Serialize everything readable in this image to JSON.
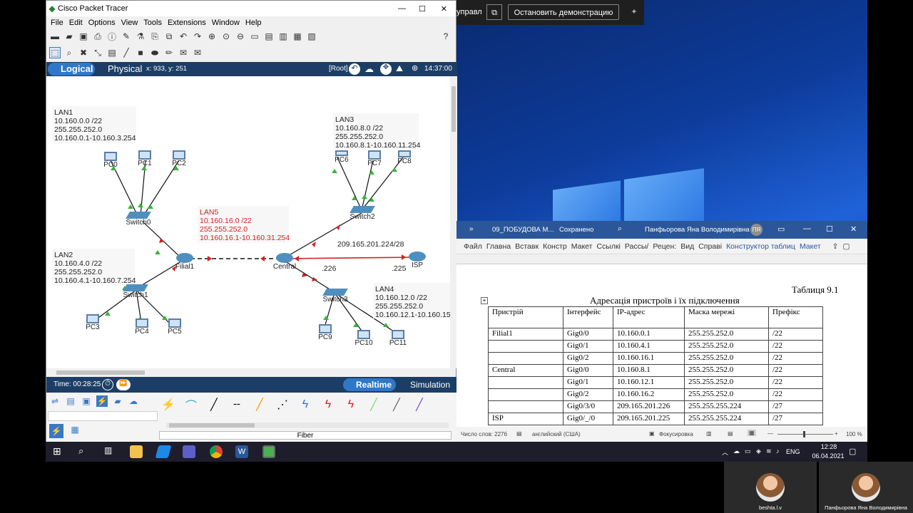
{
  "pt": {
    "title": "Cisco Packet Tracer",
    "menu": [
      "File",
      "Edit",
      "Options",
      "View",
      "Tools",
      "Extensions",
      "Window",
      "Help"
    ],
    "tab_logical": "Logical",
    "tab_physical": "Physical",
    "coords": "x: 933, y: 251",
    "root": "[Root]",
    "clock": "14:37:00",
    "time": "Time: 00:28:25",
    "realtime": "Realtime",
    "simulation": "Simulation",
    "cable_label": "Fiber"
  },
  "topology": {
    "lan1": [
      "LAN1",
      "10.160.0.0 /22",
      "255.255.252.0",
      "10.160.0.1-10.160.3.254"
    ],
    "lan2": [
      "LAN2",
      "10.160.4.0 /22",
      "255.255.252.0",
      "10.160.4.1-10.160.7.254"
    ],
    "lan3": [
      "LAN3",
      "10.160.8.0 /22",
      "255.255.252.0",
      "10.160.8.1-10.160.11.254"
    ],
    "lan4": [
      "LAN4",
      "10.160.12.0 /22",
      "255.255.252.0",
      "10.160.12.1-10.160.15"
    ],
    "lan5": [
      "LAN5",
      "10.160.16.0 /22",
      "255.255.252.0",
      "10.160.16.1-10.160.31.254"
    ],
    "isp_net": "209.165.201.224/28",
    "ip226": ".226",
    "ip225": ".225",
    "devices": {
      "pc0": "PC0",
      "pc1": "PC1",
      "pc2": "PC2",
      "pc3": "PC3",
      "pc4": "PC4",
      "pc5": "PC5",
      "pc6": "PC6",
      "pc7": "PC7",
      "pc8": "PC8",
      "pc9": "PC9",
      "pc10": "PC10",
      "pc11": "PC11",
      "switch0": "Switch0",
      "switch1": "Switch1",
      "switch2": "Switch2",
      "switch3": "Switch3",
      "filial1": "Filial1",
      "central": "Central",
      "isp": "ISP"
    }
  },
  "presenter": {
    "manage": "управл",
    "stop": "Остановить демонстрацию"
  },
  "word": {
    "filename": "09_ПОБУДОВА М...",
    "saved": "Сохранено",
    "user": "Панфьорова Яна Володимирівна",
    "initials": "ПЯ",
    "ribbon": [
      "Файл",
      "Главна",
      "Вставк",
      "Констр",
      "Макет",
      "Ссылкі",
      "Рассы/",
      "Рецен:",
      "Вид",
      "Справі",
      "Конструктор таблиц",
      "Макет"
    ],
    "caption": "Таблиця 9.1",
    "heading": "Адресація пристроїв і їх підключення",
    "headers": [
      "Пристрій",
      "Інтерфейс",
      "IP-адрес",
      "Маска мережі",
      "Префікс"
    ],
    "rows": [
      [
        "Filial1",
        "Gig0/0",
        "10.160.0.1",
        "255.255.252.0",
        "/22"
      ],
      [
        "",
        "Gig0/1",
        "10.160.4.1",
        "255.255.252.0",
        "/22"
      ],
      [
        "",
        "Gig0/2",
        "10.160.16.1",
        "255.255.252.0",
        "/22"
      ],
      [
        "Central",
        "Gig0/0",
        "10.160.8.1",
        "255.255.252.0",
        "/22"
      ],
      [
        "",
        "Gig0/1",
        "10.160.12.1",
        "255.255.252.0",
        "/22"
      ],
      [
        "",
        "Gig0/2",
        "10.160.16.2",
        "255.255.252.0",
        "/22"
      ],
      [
        "",
        "Gig0/3/0",
        "209.165.201.226",
        "255.255.255.224",
        "/27"
      ],
      [
        "ISP",
        "Gig0/_/0",
        "209.165.201.225",
        "255.255.255.224",
        "/27"
      ]
    ],
    "status_words": "Число слов: 2276",
    "status_lang": "английский (США)",
    "status_focus": "Фокусировка",
    "zoom": "100 %"
  },
  "taskbar": {
    "lang": "ENG",
    "time": "12:28",
    "date": "06.04.2021"
  },
  "video": {
    "name1": "beshta.l.v",
    "name2": "Панфьорова Яна Володимирівна"
  }
}
